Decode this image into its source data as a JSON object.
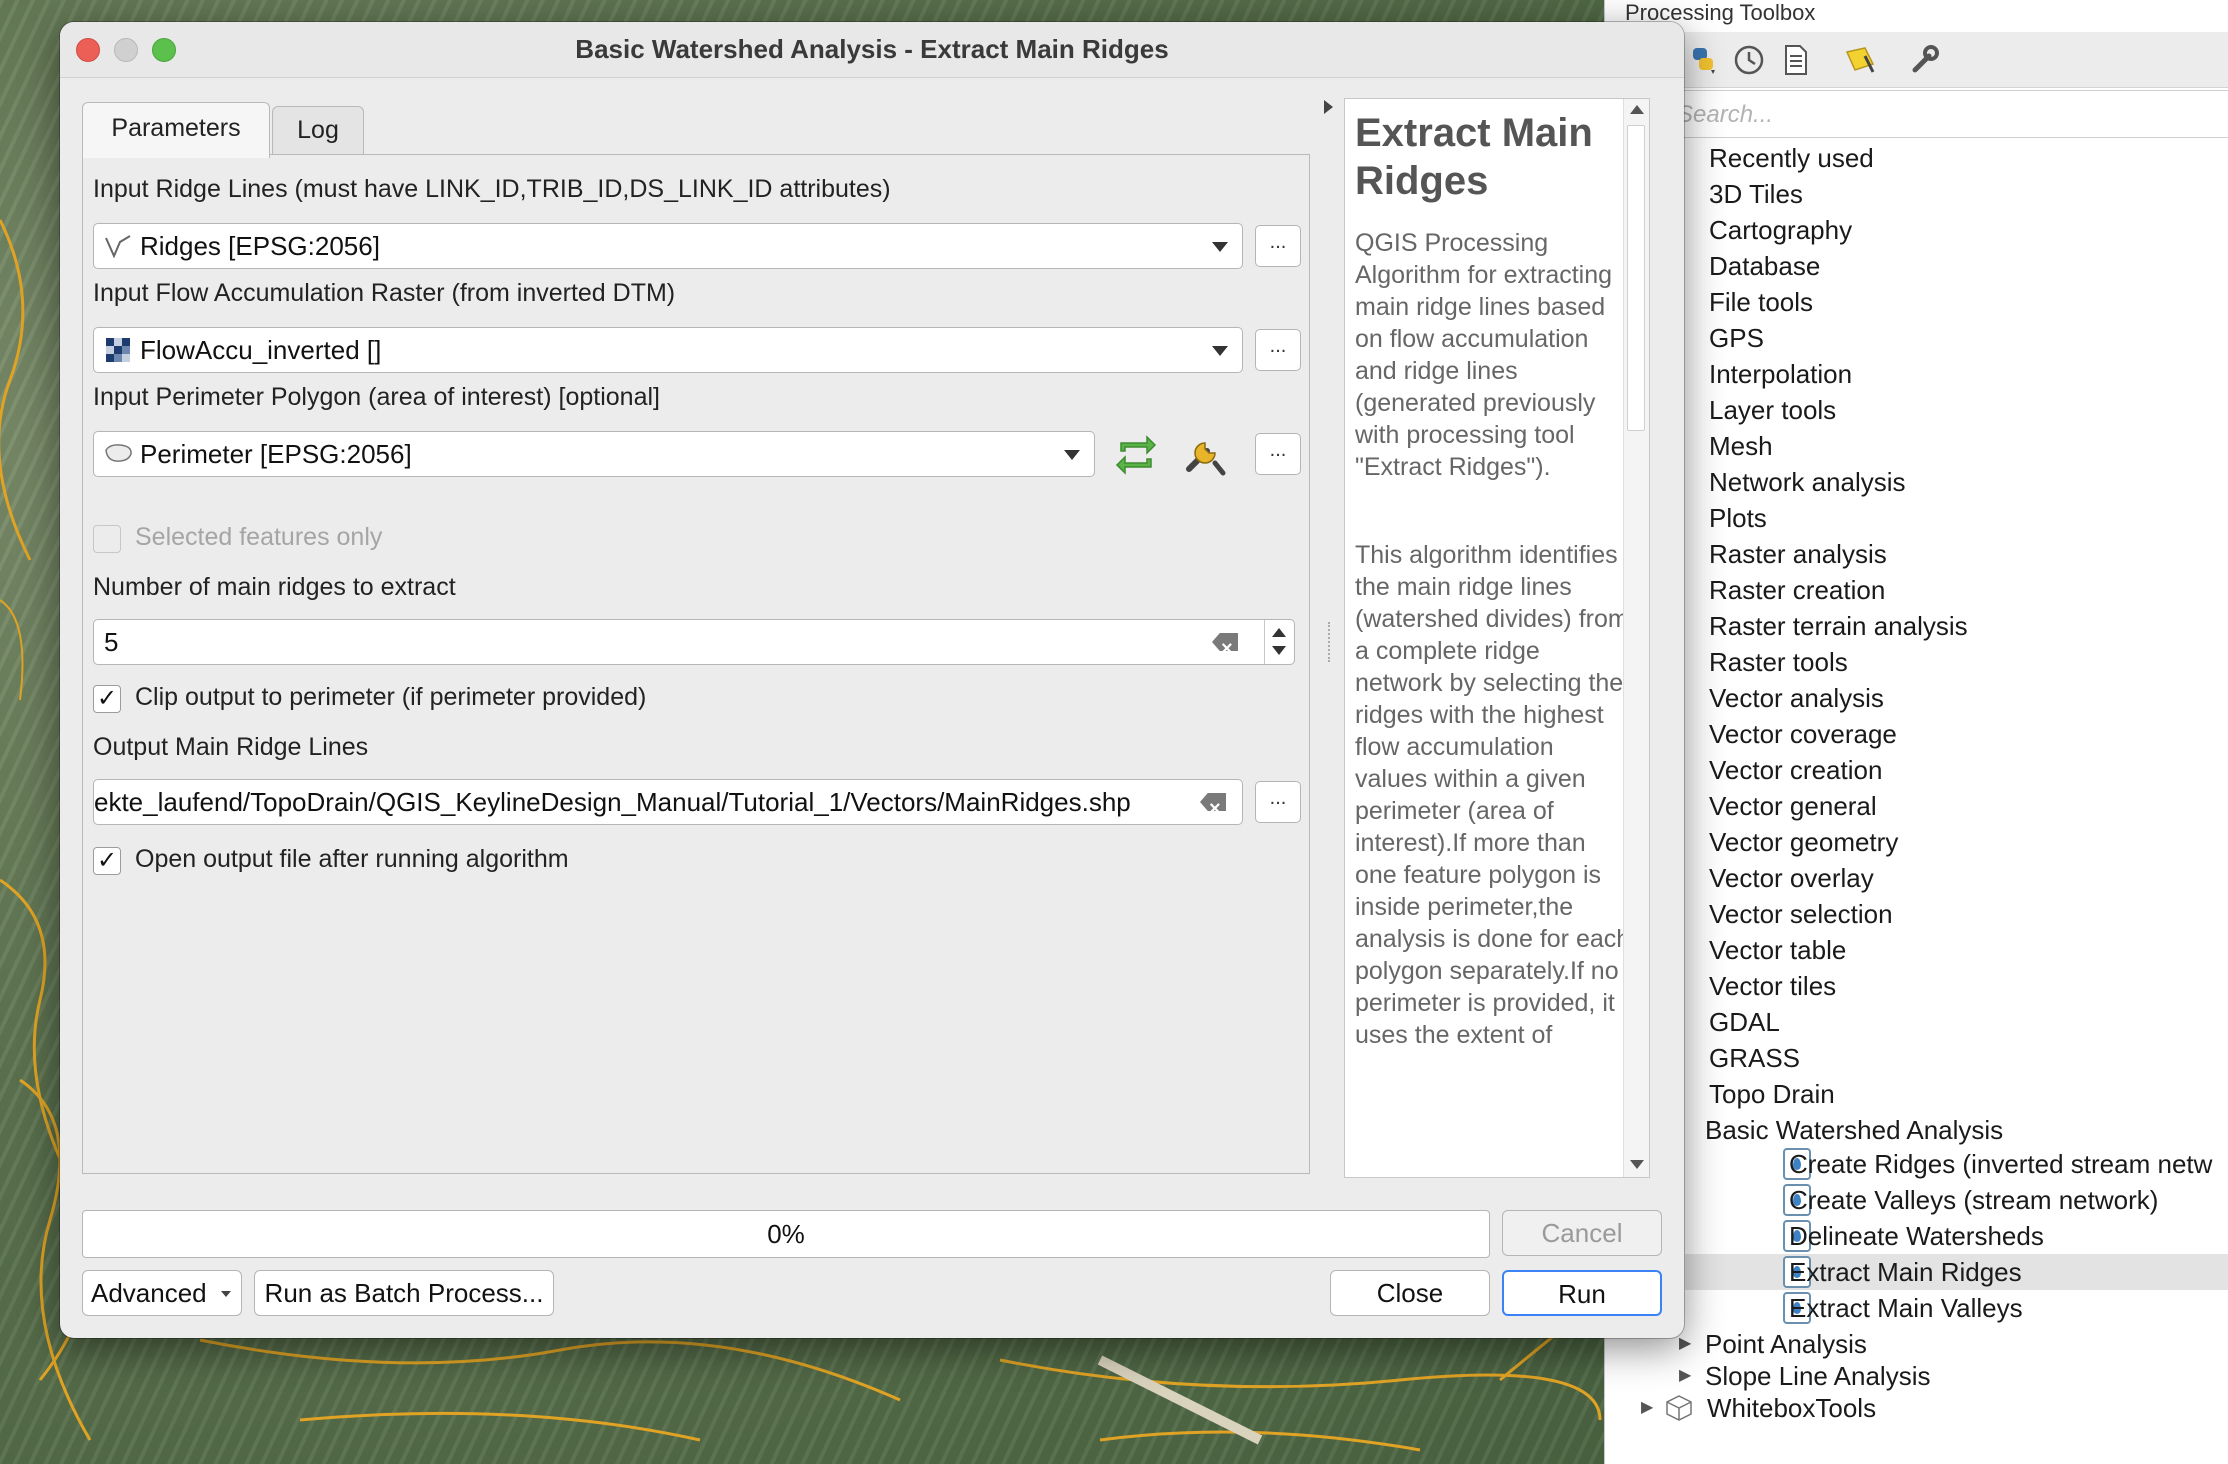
{
  "dialog": {
    "title": "Basic Watershed Analysis - Extract Main Ridges",
    "tabs": [
      "Parameters",
      "Log"
    ],
    "active_tab": "Parameters"
  },
  "params": {
    "ridge_lines_label": "Input Ridge Lines (must have LINK_ID,TRIB_ID,DS_LINK_ID attributes)",
    "ridge_lines_value": "Ridges [EPSG:2056]",
    "flow_acc_label": "Input Flow Accumulation Raster (from inverted DTM)",
    "flow_acc_value": "FlowAccu_inverted []",
    "perimeter_label": "Input Perimeter Polygon (area of interest) [optional]",
    "perimeter_value": "Perimeter [EPSG:2056]",
    "selected_only_label": "Selected features only",
    "num_ridges_label": "Number of main ridges to extract",
    "num_ridges_value": "5",
    "clip_label": "Clip output to perimeter (if perimeter provided)",
    "output_label": "Output Main Ridge Lines",
    "output_value": "ekte_laufend/TopoDrain/QGIS_KeylineDesign_Manual/Tutorial_1/Vectors/MainRidges.shp",
    "open_output_label": "Open output file after running algorithm",
    "browse_label": "..."
  },
  "help": {
    "title": "Extract Main Ridges",
    "para1": "QGIS Processing Algorithm for extracting main ridge lines based on flow accumulation and ridge lines (generated previously with processing tool \"Extract Ridges\").",
    "para2": "This algorithm identifies the main ridge lines (watershed divides) from a complete ridge network by selecting the ridges with the highest flow accumulation values within a given perimeter (area of interest).If more than one feature polygon is inside perimeter,the analysis is done for each polygon separately.If no perimeter is provided, it uses the extent of"
  },
  "footer": {
    "progress": "0%",
    "cancel": "Cancel",
    "advanced": "Advanced",
    "batch": "Run as Batch Process...",
    "close": "Close",
    "run": "Run"
  },
  "toolbox": {
    "title": "Processing Toolbox",
    "search_placeholder": "Search...",
    "groups": [
      "Recently used",
      "3D Tiles",
      "Cartography",
      "Database",
      "File tools",
      "GPS",
      "Interpolation",
      "Layer tools",
      "Mesh",
      "Network analysis",
      "Plots",
      "Raster analysis",
      "Raster creation",
      "Raster terrain analysis",
      "Raster tools",
      "Vector analysis",
      "Vector coverage",
      "Vector creation",
      "Vector general",
      "Vector geometry",
      "Vector overlay",
      "Vector selection",
      "Vector table",
      "Vector tiles",
      "GDAL",
      "GRASS",
      "Topo Drain"
    ],
    "subgroup": "Basic Watershed Analysis",
    "algorithms": [
      "Create Ridges (inverted stream netw",
      "Create Valleys (stream network)",
      "Delineate Watersheds",
      "Extract Main Ridges",
      "Extract Main Valleys"
    ],
    "selected_algorithm": "Extract Main Ridges",
    "more_groups": [
      "Point Analysis",
      "Slope Line Analysis"
    ],
    "provider_last": "WhiteboxTools"
  },
  "colors": {
    "run_border": "#3b82f6",
    "traffic_red": "#ec5f57",
    "traffic_gray": "#d0d0d0",
    "traffic_green": "#5bc04c",
    "map_line": "#e0a324"
  }
}
